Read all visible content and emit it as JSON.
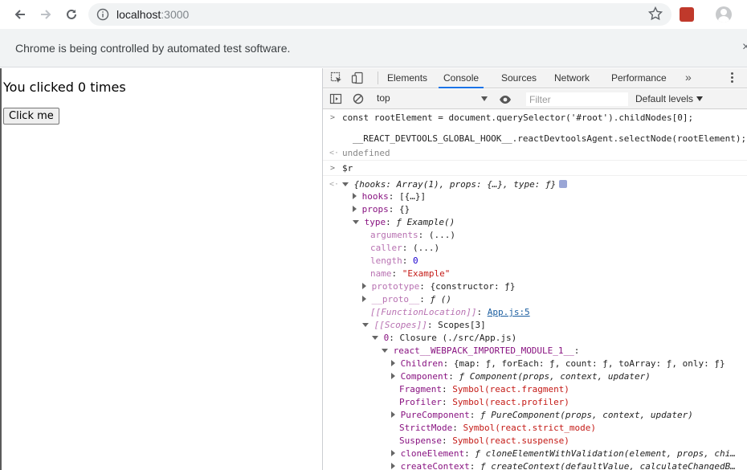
{
  "browser": {
    "url_host": "localhost",
    "url_port": ":3000",
    "infobar_text": "Chrome is being controlled by automated test software.",
    "infobar_close": "×"
  },
  "page": {
    "clicked_text": "You clicked 0 times",
    "button_label": "Click me"
  },
  "devtools": {
    "tabs": [
      "Elements",
      "Console",
      "Sources",
      "Network",
      "Performance"
    ],
    "active_tab": "Console",
    "more_tabs": "»",
    "context": "top",
    "filter_placeholder": "Filter",
    "levels": "Default levels",
    "console": {
      "cmd1_line1": "const rootElement = document.querySelector('#root').childNodes[0];",
      "cmd1_line2": "__REACT_DEVTOOLS_GLOBAL_HOOK__.reactDevtoolsAgent.selectNode(rootElement);",
      "result1": "undefined",
      "cmd2": "$r",
      "obj_summary": "{hooks: Array(1), props: {…}, type: ƒ}",
      "hooks_key": "hooks",
      "hooks_val": "[{…}]",
      "props_key": "props",
      "props_val": "{}",
      "type_key": "type",
      "type_val": "ƒ Example()",
      "arguments_key": "arguments",
      "arguments_val": "(...)",
      "caller_key": "caller",
      "caller_val": "(...)",
      "length_key": "length",
      "length_val": "0",
      "name_key": "name",
      "name_val": "\"Example\"",
      "prototype_key": "prototype",
      "prototype_val": "{constructor: ƒ}",
      "proto_key": "__proto__",
      "proto_val": "ƒ ()",
      "funcloc_key": "[[FunctionLocation]]",
      "funcloc_val": "App.js:5",
      "scopes_key": "[[Scopes]]",
      "scopes_val": "Scopes[3]",
      "scope0_key": "0",
      "scope0_val": "Closure (./src/App.js)",
      "module_key": "react__WEBPACK_IMPORTED_MODULE_1__",
      "children_key": "Children",
      "children_val": "{map: ƒ, forEach: ƒ, count: ƒ, toArray: ƒ, only: ƒ}",
      "component_key": "Component",
      "component_val": "ƒ Component(props, context, updater)",
      "fragment_key": "Fragment",
      "fragment_val": "Symbol(react.fragment)",
      "profiler_key": "Profiler",
      "profiler_val": "Symbol(react.profiler)",
      "pure_key": "PureComponent",
      "pure_val": "ƒ PureComponent(props, context, updater)",
      "strict_key": "StrictMode",
      "strict_val": "Symbol(react.strict_mode)",
      "suspense_key": "Suspense",
      "suspense_val": "Symbol(react.suspense)",
      "clone_key": "cloneElement",
      "clone_val": "ƒ cloneElementWithValidation(element, props, chi…",
      "create_key": "createContext",
      "create_val": "ƒ createContext(defaultValue, calculateChangedB…"
    }
  }
}
